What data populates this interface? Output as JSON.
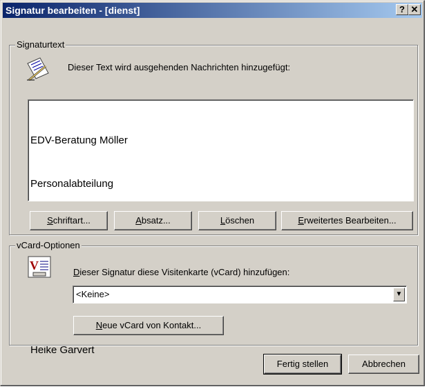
{
  "window": {
    "title": "Signatur bearbeiten - [dienst]",
    "help_glyph": "?",
    "close_glyph": "✕"
  },
  "signature_group": {
    "legend": "Signaturtext",
    "instruction": "Dieser Text wird ausgehenden Nachrichten hinzugefügt:",
    "icon": "signature-edit-icon",
    "text_lines": [
      "EDV-Beratung Möller",
      "Personalabteilung",
      "",
      "",
      "",
      "Heike Garvert"
    ]
  },
  "buttons": {
    "font_prefix": "S",
    "font_rest": "chriftart...",
    "paragraph_prefix": "A",
    "paragraph_rest": "bsatz...",
    "delete_prefix": "L",
    "delete_rest": "öschen",
    "advanced_prefix": "E",
    "advanced_rest": "rweitertes Bearbeiten...",
    "finish": "Fertig stellen",
    "cancel": "Abbrechen"
  },
  "vcard_group": {
    "legend": "vCard-Optionen",
    "icon": "vcard-icon",
    "checkbox_prefix": "D",
    "checkbox_rest": "ieser Signatur diese Visitenkarte (vCard) hinzufügen:",
    "select_value": "<Keine>",
    "new_vcard_prefix": "N",
    "new_vcard_rest": "eue vCard von Kontakt..."
  }
}
